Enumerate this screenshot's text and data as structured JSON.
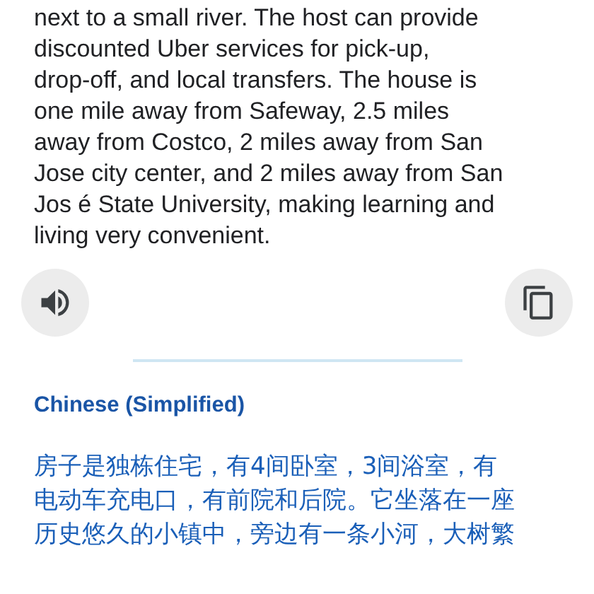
{
  "source": {
    "lines": [
      "next to a small river. The host can provide",
      "discounted Uber services for pick-up,",
      "drop-off, and local transfers. The house is",
      "one mile away from Safeway, 2.5 miles",
      "away from Costco, 2 miles away from San",
      "Jose city center, and 2 miles away from San",
      "Jos é State University, making learning and",
      "living very convenient."
    ]
  },
  "target": {
    "language": "Chinese (Simplified)",
    "lines": [
      "房子是独栋住宅，有4间卧室，3间浴室，有",
      "电动车充电口，有前院和后院。它坐落在一座",
      "历史悠久的小镇中，旁边有一条小河，大树繁"
    ]
  }
}
